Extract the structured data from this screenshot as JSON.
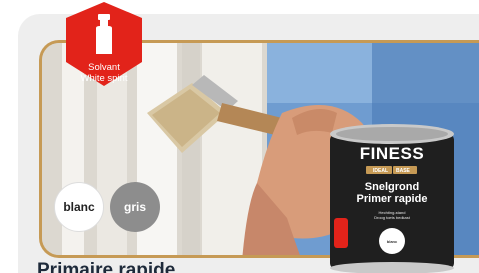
{
  "badge": {
    "line1": "Solvant",
    "line2": "White spirit",
    "icon": "solvent-bottle-icon",
    "color": "#e2231a"
  },
  "colors": [
    {
      "label": "blanc",
      "swatch": "#ffffff"
    },
    {
      "label": "gris",
      "swatch": "#8d8d8d"
    }
  ],
  "product": {
    "title": "Primaire rapide"
  },
  "can": {
    "brand": "FINESS",
    "sub1": "IDEAL",
    "sub2": "BASE",
    "name_line1": "Snelgrond",
    "name_line2": "Primer rapide",
    "small_text1": "Hechting-stand",
    "small_text2": "Droog toets bedkast",
    "label": "blanc"
  },
  "frame_color": "#c69a55"
}
